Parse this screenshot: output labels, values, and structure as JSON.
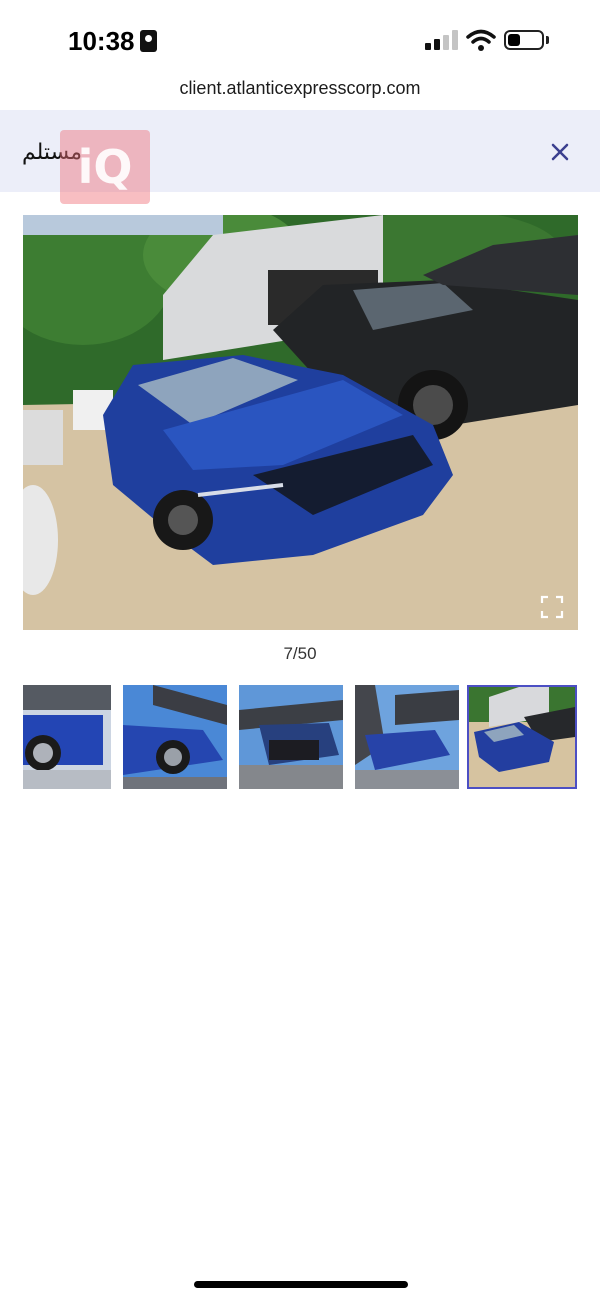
{
  "status_bar": {
    "time": "10:38",
    "icons": [
      "id-badge-icon",
      "signal-icon",
      "wifi-icon",
      "battery-icon"
    ]
  },
  "browser": {
    "url": "client.atlanticexpresscorp.com"
  },
  "header": {
    "title": "مستلم",
    "watermark": "iQ",
    "close_icon": "close-icon",
    "accent_color": "#4c4fc4",
    "background_color": "#eceef9"
  },
  "gallery": {
    "current_index": 7,
    "total": 50,
    "counter_text": "7/50",
    "expand_icon": "expand-icon",
    "thumbnails": [
      {
        "subject": "blue car front wheel on carrier"
      },
      {
        "subject": "blue car side on carrier"
      },
      {
        "subject": "blue car front damage on carrier"
      },
      {
        "subject": "blue car on carrier"
      },
      {
        "subject": "blue car in lot",
        "selected": true
      }
    ]
  }
}
